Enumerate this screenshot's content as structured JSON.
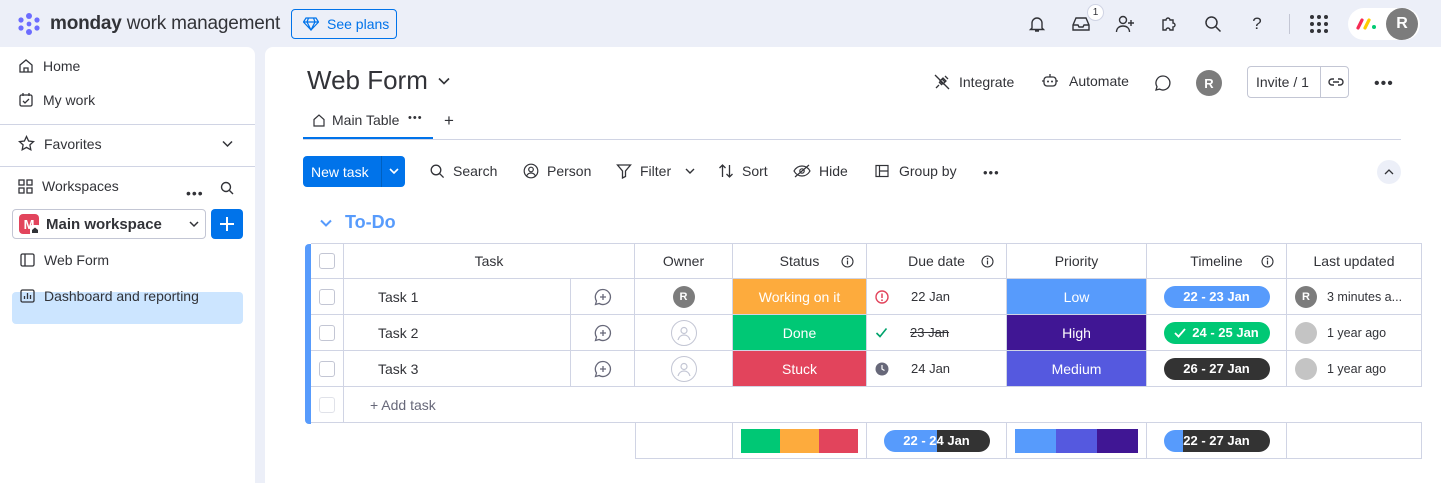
{
  "app": {
    "brand_bold": "monday",
    "brand_rest": " work management",
    "see_plans": "See plans",
    "inbox_count": "1",
    "avatar_initial": "R"
  },
  "sidebar": {
    "home": "Home",
    "my_work": "My work",
    "favorites": "Favorites",
    "workspaces": "Workspaces",
    "workspace_name": "Main workspace",
    "workspace_initial": "M",
    "items": [
      {
        "label": "Web Form"
      },
      {
        "label": "Dashboard and reporting"
      }
    ]
  },
  "board": {
    "title": "Web Form",
    "integrate": "Integrate",
    "automate": "Automate",
    "invite": "Invite / 1",
    "avatar_initial": "R",
    "tabs": [
      {
        "label": "Main Table"
      }
    ],
    "toolbar": {
      "new_task": "New task",
      "search": "Search",
      "person": "Person",
      "filter": "Filter",
      "sort": "Sort",
      "hide": "Hide",
      "group_by": "Group by"
    },
    "group": {
      "title": "To-Do",
      "add_task": "+ Add task"
    },
    "columns": [
      "Task",
      "Owner",
      "Status",
      "Due date",
      "Priority",
      "Timeline",
      "Last updated"
    ],
    "rows": [
      {
        "task": "Task 1",
        "owner": "R",
        "status": "Working on it",
        "status_color": "#fdab3d",
        "due": "22 Jan",
        "due_icon": "alert-icon",
        "priority": "Low",
        "priority_color": "#579bfc",
        "timeline": "22 - 23 Jan",
        "timeline_color": "#579bfc",
        "updated": "3 minutes a..."
      },
      {
        "task": "Task 2",
        "owner": "",
        "status": "Done",
        "status_color": "#00c875",
        "due": "23 Jan",
        "due_icon": "check-icon",
        "priority": "High",
        "priority_color": "#401694",
        "timeline": "24 - 25 Jan",
        "timeline_color": "#00c875",
        "updated": "1 year ago"
      },
      {
        "task": "Task 3",
        "owner": "",
        "status": "Stuck",
        "status_color": "#e2445c",
        "due": "24 Jan",
        "due_icon": "clock-icon",
        "priority": "Medium",
        "priority_color": "#5559df",
        "timeline": "26 - 27 Jan",
        "timeline_color": "#333333",
        "updated": "1 year ago"
      }
    ],
    "summary": {
      "due": "22 - 24 Jan",
      "timeline": "22 - 27 Jan"
    }
  },
  "colors": {
    "accent": "#0073ea",
    "group": "#579bfc"
  }
}
